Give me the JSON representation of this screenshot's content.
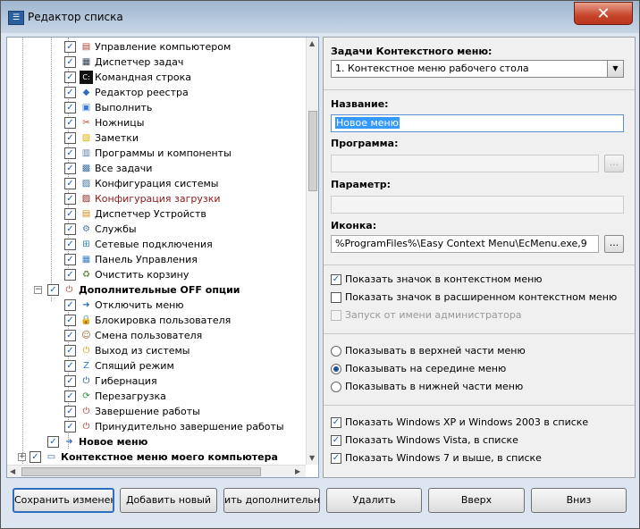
{
  "window": {
    "title": "Редактор списка",
    "close_label": "✕"
  },
  "tree": {
    "items": [
      {
        "label": "Управление компьютером",
        "checked": true,
        "icon": "computer-management-icon"
      },
      {
        "label": "Диспетчер задач",
        "checked": true,
        "icon": "task-manager-icon"
      },
      {
        "label": "Командная строка",
        "checked": true,
        "icon": "command-prompt-icon"
      },
      {
        "label": "Редактор реестра",
        "checked": true,
        "icon": "registry-editor-icon"
      },
      {
        "label": "Выполнить",
        "checked": true,
        "icon": "run-icon"
      },
      {
        "label": "Ножницы",
        "checked": true,
        "icon": "scissors-icon"
      },
      {
        "label": "Заметки",
        "checked": true,
        "icon": "sticky-notes-icon"
      },
      {
        "label": "Программы и компоненты",
        "checked": true,
        "icon": "programs-icon"
      },
      {
        "label": "Все задачи",
        "checked": true,
        "icon": "all-tasks-icon"
      },
      {
        "label": "Конфигурация системы",
        "checked": true,
        "icon": "system-config-icon"
      },
      {
        "label": "Конфигурация загрузки",
        "checked": true,
        "icon": "boot-config-icon",
        "color": "#8b1a1a"
      },
      {
        "label": "Диспетчер Устройств",
        "checked": true,
        "icon": "device-manager-icon"
      },
      {
        "label": "Службы",
        "checked": true,
        "icon": "services-icon"
      },
      {
        "label": "Сетевые подключения",
        "checked": true,
        "icon": "network-icon"
      },
      {
        "label": "Панель Управления",
        "checked": true,
        "icon": "control-panel-icon"
      },
      {
        "label": "Очистить корзину",
        "checked": true,
        "icon": "recycle-bin-icon"
      },
      {
        "label": "Дополнительные OFF опции",
        "checked": true,
        "icon": "power-off-icon",
        "group": true
      },
      {
        "label": "Отключить меню",
        "checked": true,
        "icon": "disable-menu-icon"
      },
      {
        "label": "Блокировка пользователя",
        "checked": true,
        "icon": "lock-icon"
      },
      {
        "label": "Смена пользователя",
        "checked": true,
        "icon": "switch-user-icon"
      },
      {
        "label": "Выход из системы",
        "checked": true,
        "icon": "logoff-icon"
      },
      {
        "label": "Спящий режим",
        "checked": true,
        "icon": "sleep-icon"
      },
      {
        "label": "Гибернация",
        "checked": true,
        "icon": "hibernate-icon"
      },
      {
        "label": "Перезагрузка",
        "checked": true,
        "icon": "restart-icon"
      },
      {
        "label": "Завершение работы",
        "checked": true,
        "icon": "shutdown-icon"
      },
      {
        "label": "Принудительно завершение работы",
        "checked": true,
        "icon": "force-shutdown-icon"
      },
      {
        "label": "Новое меню",
        "checked": true,
        "icon": "arrow-right-icon",
        "bold": true
      },
      {
        "label": "Контекстное меню моего компьютера",
        "checked": true,
        "icon": "my-computer-icon",
        "group": true
      }
    ]
  },
  "form": {
    "tasks_label": "Задачи Контекстного меню:",
    "tasks_value": "1. Контекстное меню рабочего стола",
    "name_label": "Название:",
    "name_value": "Новое меню",
    "program_label": "Программа:",
    "program_value": "",
    "param_label": "Параметр:",
    "param_value": "",
    "icon_label": "Иконка:",
    "icon_value": "%ProgramFiles%\\Easy Context Menu\\EcMenu.exe,9",
    "browse_label": "..."
  },
  "options": {
    "show_icon": {
      "label": "Показать значок в контекстном меню",
      "checked": true
    },
    "show_icon_ext": {
      "label": "Показать значок в расширенном контекстном меню",
      "checked": false
    },
    "run_as_admin": {
      "label": "Запуск от имени администратора",
      "checked": false,
      "disabled": true
    },
    "position_top": {
      "label": "Показывать в верхней части меню",
      "selected": false
    },
    "position_middle": {
      "label": "Показывать на середине меню",
      "selected": true
    },
    "position_bottom": {
      "label": "Показывать в нижней части меню",
      "selected": false
    },
    "win_xp": {
      "label": "Показать Windows XP и Windows 2003 в списке",
      "checked": true
    },
    "win_vista": {
      "label": "Показать Windows Vista, в списке",
      "checked": true
    },
    "win_7": {
      "label": "Показать Windows 7 и выше, в списке",
      "checked": true
    }
  },
  "buttons": {
    "save": "Сохранить изменения",
    "add_new": "Добавить новый",
    "add_extra": "ить дополнительное",
    "delete": "Удалить",
    "up": "Вверх",
    "down": "Вниз"
  },
  "colors": {
    "accent": "#2f6fbf",
    "selected": "#3399ff",
    "close": "#c7452b"
  }
}
